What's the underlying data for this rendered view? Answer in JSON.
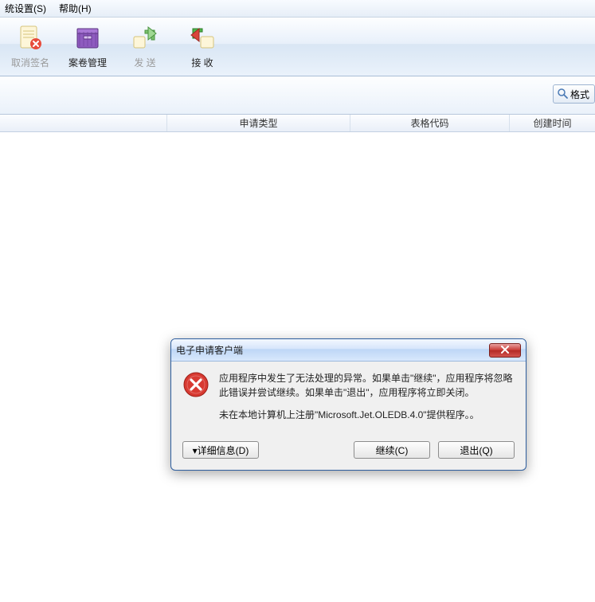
{
  "menu": {
    "settings": "统设置(S)",
    "help": "帮助(H)"
  },
  "toolbar": {
    "cancel_sign": "取消签名",
    "case_mgmt": "案卷管理",
    "send": "发 送",
    "receive": "接 收"
  },
  "format_btn": "格式",
  "columns": {
    "app_type": "申请类型",
    "form_code": "表格代码",
    "create_time": "创建时间"
  },
  "dialog": {
    "title": "电子申请客户端",
    "line1": "应用程序中发生了无法处理的异常。如果单击\"继续\"，应用程序将忽略此错误并尝试继续。如果单击\"退出\"，应用程序将立即关闭。",
    "line2": "未在本地计算机上注册\"Microsoft.Jet.OLEDB.4.0\"提供程序。。",
    "details_btn": "▾详细信息(D)",
    "continue_btn": "继续(C)",
    "exit_btn": "退出(Q)"
  }
}
